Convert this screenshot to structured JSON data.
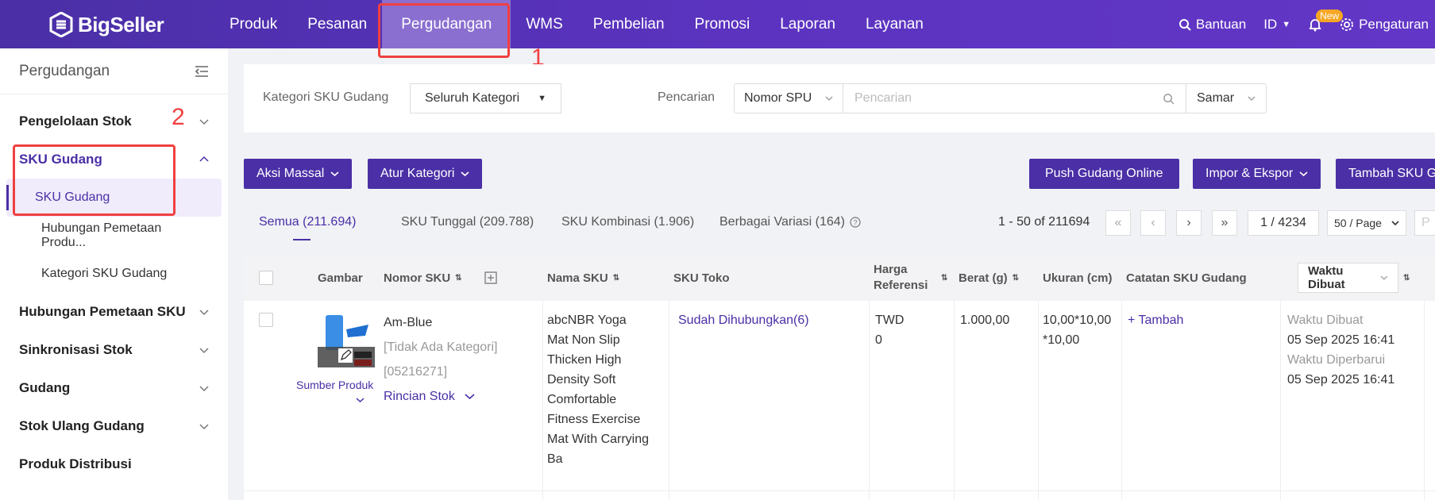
{
  "brand": {
    "name": "BigSeller"
  },
  "nav": {
    "items": [
      "Produk",
      "Pesanan",
      "Pergudangan",
      "WMS",
      "Pembelian",
      "Promosi",
      "Laporan",
      "Layanan"
    ],
    "active_index": 2
  },
  "topright": {
    "help": "Bantuan",
    "lang": "ID",
    "new_badge": "New",
    "settings": "Pengaturan"
  },
  "annotations": {
    "one": "1",
    "two": "2"
  },
  "sidebar": {
    "title": "Pergudangan",
    "groups": [
      {
        "label": "Pengelolaan Stok"
      },
      {
        "label": "SKU Gudang"
      },
      {
        "label": "Hubungan Pemetaan SKU"
      },
      {
        "label": "Sinkronisasi Stok"
      },
      {
        "label": "Gudang"
      },
      {
        "label": "Stok Ulang Gudang"
      },
      {
        "label": "Produk Distribusi"
      }
    ],
    "subitems": [
      "SKU Gudang",
      "Hubungan Pemetaan Produ...",
      "Kategori SKU Gudang"
    ]
  },
  "filters": {
    "category_label": "Kategori SKU Gudang",
    "category_value": "Seluruh Kategori",
    "search_label": "Pencarian",
    "search_type": "Nomor SPU",
    "search_placeholder": "Pencarian",
    "match_mode": "Samar"
  },
  "toolbar": {
    "bulk_action": "Aksi Massal",
    "set_category": "Atur Kategori",
    "push_online": "Push Gudang Online",
    "import_export": "Impor & Ekspor",
    "add_sku": "Tambah SKU G"
  },
  "tabs": {
    "all": "Semua (211.694)",
    "single": "SKU Tunggal (209.788)",
    "combo": "SKU Kombinasi (1.906)",
    "variants": "Berbagai Variasi (164)"
  },
  "pagination": {
    "range": "1 - 50 of 211694",
    "page": "1 / 4234",
    "page_size": "50 / Page",
    "goto_placeholder": "P"
  },
  "table": {
    "headers": {
      "image": "Gambar",
      "sku_no": "Nomor SKU",
      "sku_name": "Nama SKU",
      "store_sku": "SKU Toko",
      "ref_price_1": "Harga",
      "ref_price_2": "Referensi",
      "weight": "Berat (g)",
      "size": "Ukuran (cm)",
      "notes": "Catatan SKU Gudang",
      "time": "Waktu Dibuat"
    },
    "row": {
      "image_source": "Sumber Produk",
      "sku_no": "Am-Blue",
      "category": "[Tidak Ada Kategori]",
      "code": "[05216271]",
      "stock_detail": "Rincian Stok",
      "name_lines": [
        "abcNBR Yoga",
        "Mat Non Slip",
        "Thicken High",
        "Density Soft",
        "Comfortable",
        "Fitness Exercise",
        "Mat With Carrying",
        "Ba"
      ],
      "store_sku": "Sudah Dihubungkan(6)",
      "currency": "TWD",
      "price": "0",
      "weight": "1.000,00",
      "size_line1": "10,00*10,00",
      "size_line2": "*10,00",
      "notes_add": "+ Tambah",
      "created_label": "Waktu Dibuat",
      "created_value": "05 Sep 2025 16:41",
      "updated_label": "Waktu Diperbarui",
      "updated_value": "05 Sep 2025 16:41"
    }
  },
  "colors": {
    "brand": "#4a2fa6",
    "annotation": "#f04040",
    "badge": "#f5a623"
  }
}
